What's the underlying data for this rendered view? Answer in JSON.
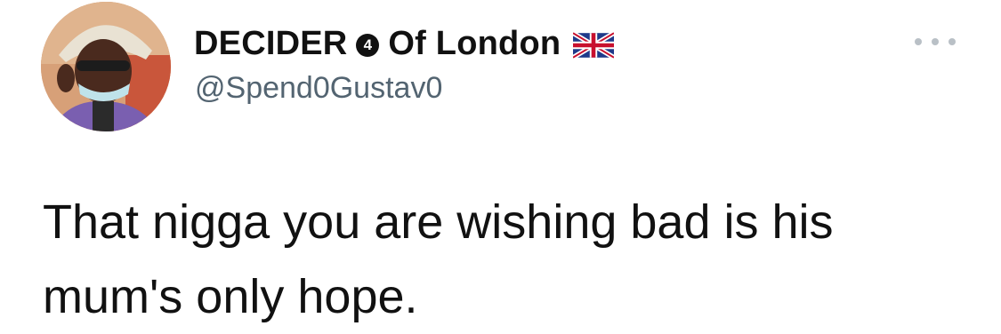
{
  "tweet": {
    "display_name_part1": "DECIDER",
    "badge_number": "4",
    "display_name_part2": "Of London",
    "handle": "@Spend0Gustav0",
    "text_line1": "That nigga you are wishing bad is his",
    "text_line2": "mum's only hope.",
    "icons": {
      "flag": "uk-flag-icon",
      "more": "more-options-icon",
      "badge": "number-badge-icon"
    }
  },
  "colors": {
    "name": "#111111",
    "handle": "#536471",
    "more_dots": "#b9c0c6",
    "flag_blue": "#1f3a8a",
    "flag_red": "#c8102e"
  }
}
